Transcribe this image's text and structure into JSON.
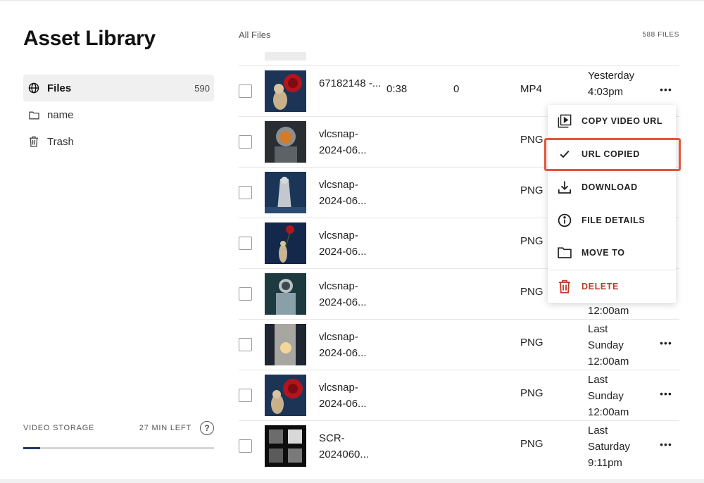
{
  "sidebar": {
    "title": "Asset Library",
    "nav": [
      {
        "label": "Files",
        "count": "590",
        "icon": "globe-icon",
        "active": true
      },
      {
        "label": "name",
        "count": "",
        "icon": "folder-icon",
        "active": false
      },
      {
        "label": "Trash",
        "count": "",
        "icon": "trash-icon",
        "active": false
      }
    ],
    "storage": {
      "label": "VIDEO STORAGE",
      "remaining": "27 MIN LEFT",
      "help": "?",
      "used_fraction": 0.09
    }
  },
  "main": {
    "section_label": "All Files",
    "file_count": "588 FILES",
    "rows": [
      {
        "name": "67182148 -...",
        "duration": "0:38",
        "views": "0",
        "type": "MP4",
        "date": "Yesterday 4:03pm"
      },
      {
        "name": "vlcsnap- 2024-06...",
        "duration": "",
        "views": "",
        "type": "PNG",
        "date": ""
      },
      {
        "name": "vlcsnap- 2024-06...",
        "duration": "",
        "views": "",
        "type": "PNG",
        "date": ""
      },
      {
        "name": "vlcsnap- 2024-06...",
        "duration": "",
        "views": "",
        "type": "PNG",
        "date": ""
      },
      {
        "name": "vlcsnap- 2024-06...",
        "duration": "",
        "views": "",
        "type": "PNG",
        "date": "12:00am"
      },
      {
        "name": "vlcsnap- 2024-06...",
        "duration": "",
        "views": "",
        "type": "PNG",
        "date": "Last Sunday 12:00am"
      },
      {
        "name": "vlcsnap- 2024-06...",
        "duration": "",
        "views": "",
        "type": "PNG",
        "date": "Last Sunday 12:00am"
      },
      {
        "name": "SCR- 2024060...",
        "duration": "",
        "views": "",
        "type": "PNG",
        "date": "Last Saturday 9:11pm"
      }
    ]
  },
  "menu": {
    "items": [
      {
        "label": "COPY VIDEO URL",
        "icon": "video-library-icon"
      },
      {
        "label": "URL COPIED",
        "icon": "checkmark-icon"
      },
      {
        "label": "DOWNLOAD",
        "icon": "download-icon"
      },
      {
        "label": "FILE DETAILS",
        "icon": "info-icon"
      },
      {
        "label": "MOVE TO",
        "icon": "folder-icon"
      },
      {
        "label": "DELETE",
        "icon": "trash-icon"
      }
    ],
    "highlight_color": "#e2573b",
    "delete_color": "#c0392b"
  },
  "colors": {
    "progress_fill": "#1d3a73",
    "active_nav_bg": "#f0f0f0"
  }
}
